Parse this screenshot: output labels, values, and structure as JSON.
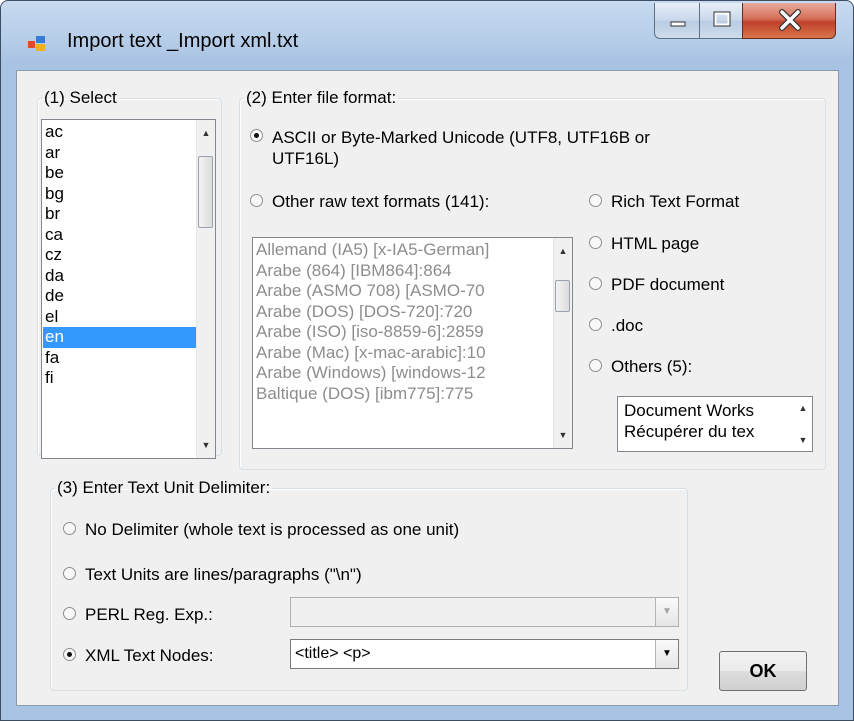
{
  "window": {
    "title": "Import text _Import xml.txt",
    "controls": {
      "minimize": "minimize",
      "maximize": "maximize",
      "close": "close"
    }
  },
  "select_group": {
    "legend": "(1) Select",
    "items": [
      "ac",
      "ar",
      "be",
      "bg",
      "br",
      "ca",
      "cz",
      "da",
      "de",
      "el",
      "en",
      "fa",
      "fi"
    ],
    "selected": "en"
  },
  "format_group": {
    "legend": "(2) Enter file format:",
    "ascii_label_line1": "ASCII or Byte-Marked Unicode (UTF8, UTF16B or",
    "ascii_label_line2": "UTF16L)",
    "ascii_checked": true,
    "other_raw_label": "Other raw text formats (141):",
    "encodings": [
      "Allemand (IA5) [x-IA5-German]",
      "Arabe (864) [IBM864]:864",
      "Arabe (ASMO 708) [ASMO-70",
      "Arabe (DOS) [DOS-720]:720",
      "Arabe (ISO) [iso-8859-6]:2859",
      "Arabe (Mac) [x-mac-arabic]:10",
      "Arabe (Windows) [windows-12",
      "Baltique (DOS) [ibm775]:775"
    ],
    "rtf_label": "Rich Text Format",
    "html_label": "HTML page",
    "pdf_label": "PDF document",
    "doc_label": ".doc",
    "others_label": "Others (5):",
    "others_items": [
      "Document Works",
      "Récupérer du tex"
    ]
  },
  "delimiter_group": {
    "legend": "(3) Enter Text Unit Delimiter:",
    "no_delim_label": "No Delimiter (whole text is processed as one unit)",
    "lines_label": "Text Units are lines/paragraphs (\"\\n\")",
    "perl_label": "PERL Reg. Exp.:",
    "perl_value": "",
    "xml_label": "XML Text Nodes:",
    "xml_value": "<title> <p>",
    "xml_checked": true
  },
  "ok_button": "OK"
}
